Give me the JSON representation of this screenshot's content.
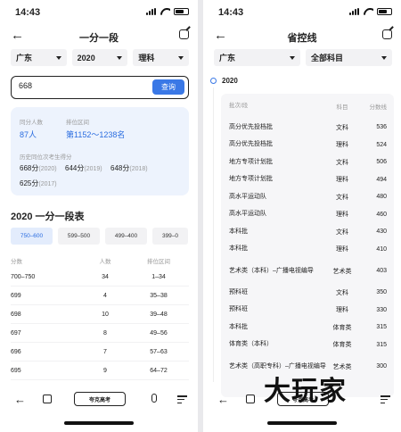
{
  "left": {
    "status": {
      "time": "14:43"
    },
    "nav": {
      "title": "一分一段"
    },
    "filters": {
      "province": "广东",
      "year": "2020",
      "subject": "理科"
    },
    "search": {
      "value": "668",
      "button": "查询"
    },
    "summary": {
      "count_label": "同分人数",
      "count_value": "87人",
      "rank_label": "排位区间",
      "rank_value": "第1152～1238名",
      "history_label": "历史同位次考生得分",
      "history": [
        {
          "score": "668分",
          "year": "(2020)"
        },
        {
          "score": "644分",
          "year": "(2019)"
        },
        {
          "score": "648分",
          "year": "(2018)"
        },
        {
          "score": "625分",
          "year": "(2017)"
        }
      ]
    },
    "section_title": "2020 一分一段表",
    "ranges": [
      "750–600",
      "599–500",
      "499–400",
      "399–0"
    ],
    "table": {
      "headers": [
        "分数",
        "人数",
        "排位区间"
      ],
      "rows": [
        [
          "700–750",
          "34",
          "1–34"
        ],
        [
          "699",
          "4",
          "35–38"
        ],
        [
          "698",
          "10",
          "39–48"
        ],
        [
          "697",
          "8",
          "49–56"
        ],
        [
          "696",
          "7",
          "57–63"
        ],
        [
          "695",
          "9",
          "64–72"
        ]
      ]
    },
    "toolbar": {
      "pill": "夸克高考"
    }
  },
  "right": {
    "status": {
      "time": "14:43"
    },
    "nav": {
      "title": "省控线"
    },
    "filters": {
      "province": "广东",
      "category": "全部科目"
    },
    "year": "2020",
    "table": {
      "headers": [
        "批次/段",
        "科目",
        "分数线"
      ],
      "rows": [
        [
          "高分优先投档批",
          "文科",
          "536"
        ],
        [
          "高分优先投档批",
          "理科",
          "524"
        ],
        [
          "地方专项计划批",
          "文科",
          "506"
        ],
        [
          "地方专项计划批",
          "理科",
          "494"
        ],
        [
          "高水平运动队",
          "文科",
          "480"
        ],
        [
          "高水平运动队",
          "理科",
          "460"
        ],
        [
          "本科批",
          "文科",
          "430"
        ],
        [
          "本科批",
          "理科",
          "410"
        ],
        [
          "艺术类（本科）–广播电视编导",
          "艺术类",
          "403"
        ],
        [
          "预科班",
          "文科",
          "350"
        ],
        [
          "预科班",
          "理科",
          "330"
        ],
        [
          "本科批",
          "体育类",
          "315"
        ],
        [
          "体育类（本科）",
          "体育类",
          "315"
        ],
        [
          "艺术类（高职专科）–广播电视编导",
          "艺术类",
          "300"
        ]
      ]
    },
    "toolbar": {
      "pill": "夸克高考"
    }
  },
  "watermark": "大玩家",
  "colors": {
    "accent": "#3a78e6",
    "card_bg": "#edf3fd"
  }
}
